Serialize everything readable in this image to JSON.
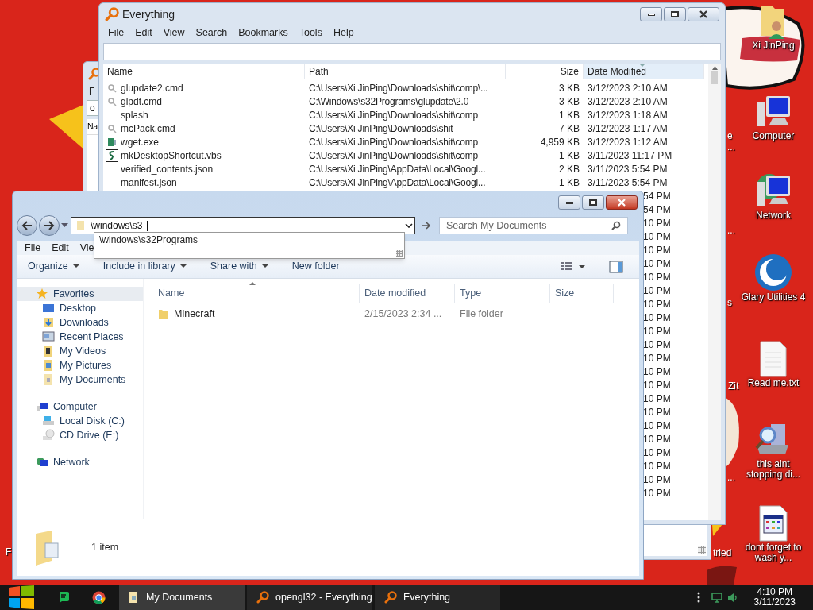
{
  "desktop": {
    "icons": [
      {
        "label": "Xi JinPing",
        "kind": "user"
      },
      {
        "label": "Computer",
        "kind": "computer"
      },
      {
        "label": "Network",
        "kind": "network"
      },
      {
        "label": "Glary Utilities 4",
        "kind": "glary"
      },
      {
        "label": "Read me.txt",
        "kind": "text"
      },
      {
        "label": "this aint stopping di...",
        "kind": "setup"
      },
      {
        "label": "dont forget to wash y...",
        "kind": "app"
      }
    ],
    "partial_labels": [
      "e",
      "...",
      "...",
      "s",
      "Zit",
      "...",
      "F",
      "tried"
    ]
  },
  "back_window": {
    "menu_fragment": "F",
    "search_fragment": "o",
    "header_fragment": "Na"
  },
  "everything": {
    "title": "Everything",
    "menu": [
      "File",
      "Edit",
      "View",
      "Search",
      "Bookmarks",
      "Tools",
      "Help"
    ],
    "columns": [
      {
        "label": "Name",
        "sorted": false
      },
      {
        "label": "Path",
        "sorted": false
      },
      {
        "label": "Size",
        "sorted": false
      },
      {
        "label": "Date Modified",
        "sorted": true
      }
    ],
    "rows": [
      {
        "name": "glupdate2.cmd",
        "path": "C:\\Users\\Xi JinPing\\Downloads\\shit\\comp\\...",
        "size": "3 KB",
        "date": "3/12/2023 2:10 AM",
        "kind": "cmd"
      },
      {
        "name": "glpdt.cmd",
        "path": "C:\\Windows\\s32Programs\\glupdate\\2.0",
        "size": "3 KB",
        "date": "3/12/2023 2:10 AM",
        "kind": "cmd"
      },
      {
        "name": "splash",
        "path": "C:\\Users\\Xi JinPing\\Downloads\\shit\\comp",
        "size": "1 KB",
        "date": "3/12/2023 1:18 AM",
        "kind": "file"
      },
      {
        "name": "mcPack.cmd",
        "path": "C:\\Users\\Xi JinPing\\Downloads\\shit",
        "size": "7 KB",
        "date": "3/12/2023 1:17 AM",
        "kind": "cmd"
      },
      {
        "name": "wget.exe",
        "path": "C:\\Users\\Xi JinPing\\Downloads\\shit\\comp",
        "size": "4,959 KB",
        "date": "3/12/2023 1:12 AM",
        "kind": "exe"
      },
      {
        "name": "mkDesktopShortcut.vbs",
        "path": "C:\\Users\\Xi JinPing\\Downloads\\shit\\comp",
        "size": "1 KB",
        "date": "3/11/2023 11:17 PM",
        "kind": "script"
      },
      {
        "name": "verified_contents.json",
        "path": "C:\\Users\\Xi JinPing\\AppData\\Local\\Googl...",
        "size": "2 KB",
        "date": "3/11/2023 5:54 PM",
        "kind": "file"
      },
      {
        "name": "manifest.json",
        "path": "C:\\Users\\Xi JinPing\\AppData\\Local\\Googl...",
        "size": "1 KB",
        "date": "3/11/2023 5:54 PM",
        "kind": "file"
      }
    ],
    "partial_dates": [
      "54 PM",
      "54 PM",
      "10 PM",
      "10 PM",
      "10 PM",
      "10 PM",
      "10 PM",
      "10 PM",
      "10 PM",
      "10 PM",
      "10 PM",
      "10 PM",
      "10 PM",
      "10 PM",
      "10 PM",
      "10 PM",
      "10 PM",
      "10 PM",
      "10 PM",
      "10 PM",
      "10 PM",
      "10 PM",
      "10 PM"
    ]
  },
  "explorer": {
    "address": "\\windows\\s3",
    "suggestion": "\\windows\\s32Programs",
    "search_placeholder": "Search My Documents",
    "menu": [
      "File",
      "Edit",
      "Vie"
    ],
    "toolbar": [
      {
        "label": "Organize",
        "dropdown": true
      },
      {
        "label": "Include in library",
        "dropdown": true
      },
      {
        "label": "Share with",
        "dropdown": true
      },
      {
        "label": "New folder",
        "dropdown": false
      }
    ],
    "nav": [
      {
        "label": "Favorites",
        "kind": "star",
        "selected": true,
        "children": [
          {
            "label": "Desktop",
            "kind": "desktop",
            "selected": false
          },
          {
            "label": "Downloads",
            "kind": "download",
            "selected": false
          },
          {
            "label": "Recent Places",
            "kind": "recent",
            "selected": false
          },
          {
            "label": "My Videos",
            "kind": "video",
            "selected": false
          },
          {
            "label": "My Pictures",
            "kind": "picture",
            "selected": false
          },
          {
            "label": "My Documents",
            "kind": "document",
            "selected": false
          }
        ]
      },
      {
        "label": "Computer",
        "kind": "computer",
        "selected": false,
        "children": [
          {
            "label": "Local Disk (C:)",
            "kind": "disk",
            "selected": false
          },
          {
            "label": "CD Drive (E:)",
            "kind": "cd",
            "selected": false
          }
        ]
      },
      {
        "label": "Network",
        "kind": "network",
        "selected": false
      }
    ],
    "columns": [
      "Name",
      "Date modified",
      "Type",
      "Size"
    ],
    "rows": [
      {
        "name": "Minecraft",
        "date": "2/15/2023 2:34 ...",
        "type": "File folder"
      }
    ],
    "status": "1 item"
  },
  "taskbar": {
    "buttons": [
      {
        "label": "My Documents",
        "kind": "folder",
        "selected": true
      },
      {
        "label": "opengl32 - Everything",
        "kind": "everything",
        "selected": false
      },
      {
        "label": "Everything",
        "kind": "everything",
        "selected": false
      }
    ],
    "time": "4:10 PM",
    "date": "3/11/2023"
  }
}
